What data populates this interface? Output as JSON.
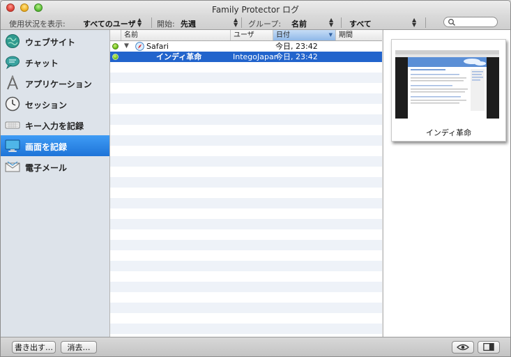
{
  "window": {
    "title": "Family Protector ログ"
  },
  "toolbar": {
    "usage_label": "使用状況を表示:",
    "usage_value": "すべてのユーザ",
    "start_label": "開始:",
    "start_value": "先週",
    "group_label": "グループ:",
    "group_value": "名前",
    "filter_value": "すべて"
  },
  "sidebar": {
    "items": [
      {
        "label": "ウェブサイト",
        "icon": "globe-icon"
      },
      {
        "label": "チャット",
        "icon": "chat-bubble-icon"
      },
      {
        "label": "アプリケーション",
        "icon": "applications-icon"
      },
      {
        "label": "セッション",
        "icon": "clock-icon"
      },
      {
        "label": "キー入力を記録",
        "icon": "keyboard-icon"
      },
      {
        "label": "画面を記録",
        "icon": "monitor-icon",
        "selected": true
      },
      {
        "label": "電子メール",
        "icon": "envelope-icon"
      }
    ]
  },
  "list": {
    "columns": [
      {
        "label": "名前"
      },
      {
        "label": "ユーザ"
      },
      {
        "label": "日付",
        "sorted": true
      },
      {
        "label": "期間"
      }
    ],
    "rows": [
      {
        "name": "Safari",
        "user": "",
        "date": "今日, 23:42",
        "duration": "",
        "expanded": true,
        "icon": "safari-icon"
      },
      {
        "name": "インディ革命",
        "user": "IntegoJapan",
        "date": "今日, 23:42",
        "duration": "",
        "selected": true
      }
    ]
  },
  "preview": {
    "caption": "インディ革命"
  },
  "bottom": {
    "export_label": "書き出す…",
    "delete_label": "消去…"
  },
  "colors": {
    "selection": "#2264cc",
    "sidebar_selection": "#2f88ea",
    "status_green": "#6cbc16"
  }
}
